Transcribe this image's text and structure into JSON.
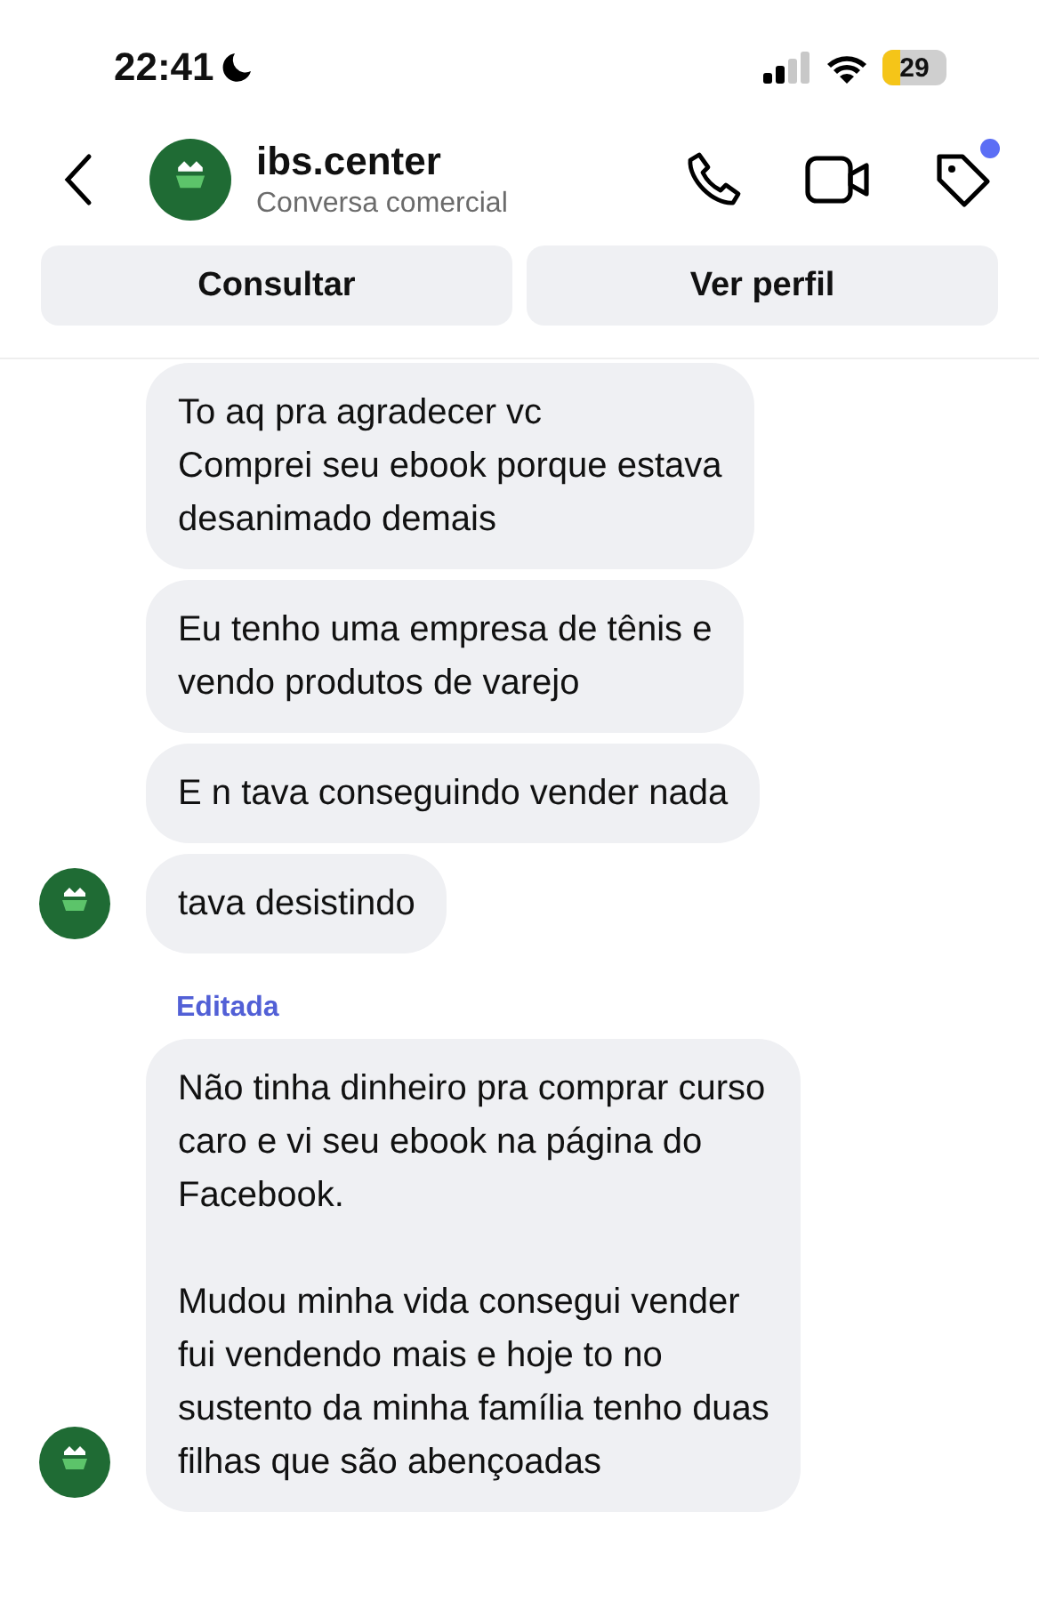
{
  "status_bar": {
    "time": "22:41",
    "focus_mode": true,
    "battery": {
      "reading": "29",
      "level": 0.29,
      "low_power": true
    }
  },
  "header": {
    "name": "ibs.center",
    "subtitle": "Conversa comercial",
    "tag_notification": true
  },
  "actions": [
    "Consultar",
    "Ver perfil"
  ],
  "groups": [
    {
      "messages": [
        "To aq pra agradecer vc\nComprei seu ebook porque estava\ndesanimado demais",
        "Eu tenho uma empresa de tênis e\nvendo produtos de varejo",
        "E n tava conseguindo vender nada",
        "tava desistindo"
      ]
    },
    {
      "label": "Editada",
      "messages": [
        "Não tinha dinheiro pra comprar curso\ncaro e vi seu ebook na página do\nFacebook.\n\nMudou minha vida consegui vender\nfui vendendo mais e hoje to no\nsustento da minha família tenho duas\nfilhas que são abençoadas"
      ]
    }
  ]
}
